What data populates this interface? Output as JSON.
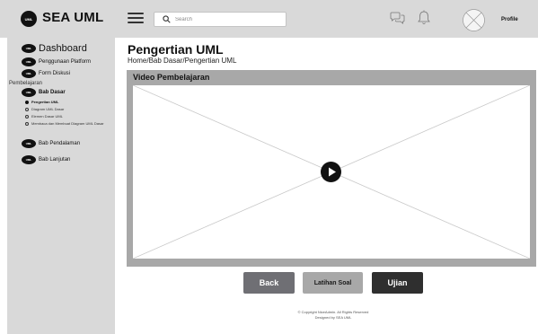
{
  "app": {
    "logo_text": "UML",
    "title": "SEA UML"
  },
  "header": {
    "search_placeholder": "Search",
    "profile_label": "Profile"
  },
  "sidebar": {
    "badge_text": "UML",
    "main_items": [
      {
        "label": "Dashboard"
      },
      {
        "label": "Penggunaan Platform"
      },
      {
        "label": "Form Diskusi"
      }
    ],
    "section_label": "Pembelajaran",
    "active_group": {
      "label": "Bab Dasar"
    },
    "sub_items": [
      {
        "label": "Pengertian UML",
        "active": true
      },
      {
        "label": "Diagram UML Dasar",
        "active": false
      },
      {
        "label": "Elemen Dasar UML",
        "active": false
      },
      {
        "label": "Membaca dan Membuat Diagram UML Dasar",
        "active": false
      }
    ],
    "other_groups": [
      {
        "label": "Bab Pendalaman"
      },
      {
        "label": "Bab Lanjutan"
      }
    ]
  },
  "main": {
    "title": "Pengertian UML",
    "breadcrumb": "Home/Bab Dasar/Pengertian UML",
    "video_header": "Video Pembelajaran"
  },
  "actions": {
    "back": "Back",
    "latihan": "Latihan Soal",
    "ujian": "Ujian"
  },
  "footer": {
    "line1": "© Copyright NiceAdmin. All Rights Reserved",
    "line2": "Designed by SEA UML"
  },
  "colors": {
    "topbar": "#d9d9d9",
    "sidebar": "#d9d9d9",
    "video_panel": "#a8a8a8",
    "back_button": "#6f6f74",
    "latihan_button": "#a8a8a8",
    "ujian_button": "#2f2f2f"
  },
  "icons": [
    "uml-logo",
    "hamburger-icon",
    "search-icon",
    "chat-icon",
    "bell-icon",
    "avatar-placeholder-icon",
    "play-icon"
  ]
}
